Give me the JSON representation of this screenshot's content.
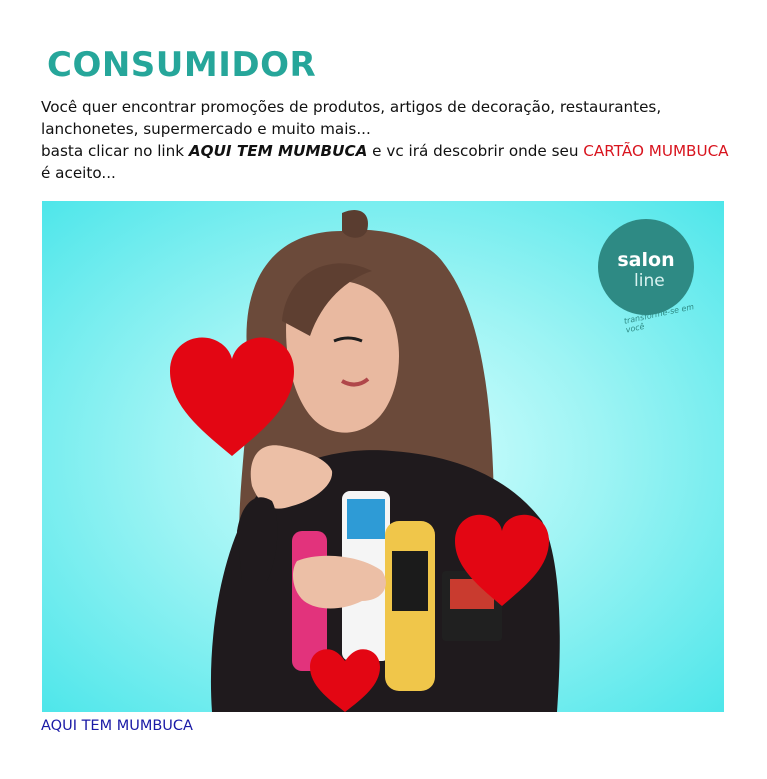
{
  "page": {
    "title": "CONSUMIDOR",
    "intro": {
      "line1": "Você quer encontrar promoções de produtos, artigos de decoração, restaurantes, lanchonetes, supermercado e muito mais...",
      "line2_prefix": "basta clicar no link ",
      "link_emphasis": "AQUI TEM MUMBUCA",
      "line2_middle": " e vc irá descobrir onde seu ",
      "card_name": "CARTÃO MUMBUCA",
      "line2_suffix": " é aceito..."
    },
    "link_text": "AQUI TEM MUMBUCA"
  },
  "banner": {
    "brand_line1": "salon",
    "brand_line2": "line",
    "brand_tagline": "transforme-se em você"
  },
  "colors": {
    "title": "#26a69a",
    "highlight": "#d8141e",
    "link": "#1a1aa6",
    "heart": "#e30613",
    "banner_bg": "#4ee6ea"
  },
  "icons": [
    "heart-icon",
    "salon-line-logo"
  ]
}
